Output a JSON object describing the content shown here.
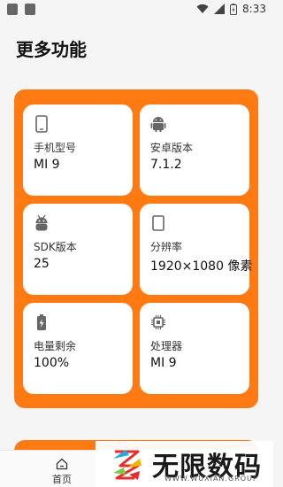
{
  "status_bar": {
    "time": "8:33",
    "icons": [
      "notification-icon",
      "image-icon",
      "wifi-icon",
      "signal-icon",
      "battery-icon"
    ]
  },
  "page": {
    "title": "更多功能"
  },
  "cards": [
    {
      "icon": "phone-icon",
      "label": "手机型号",
      "value": "MI 9"
    },
    {
      "icon": "android-icon",
      "label": "安卓版本",
      "value": "7.1.2"
    },
    {
      "icon": "android-robot-icon",
      "label": "SDK版本",
      "value": "25"
    },
    {
      "icon": "screen-icon",
      "label": "分辨率",
      "value": "1920×1080 像素"
    },
    {
      "icon": "battery-charging-icon",
      "label": "电量剩余",
      "value": "100%"
    },
    {
      "icon": "cpu-icon",
      "label": "处理器",
      "value": "MI 9"
    }
  ],
  "bottom_nav": {
    "items": [
      {
        "icon": "home-icon",
        "label": "首页"
      }
    ]
  },
  "watermark": {
    "title": "无限数码",
    "subtitle": "WWW.WUXIAN.GROUP"
  },
  "colors": {
    "accent": "#ff7a12",
    "card_bg": "#ffffff",
    "page_bg": "#f5f5f5"
  }
}
